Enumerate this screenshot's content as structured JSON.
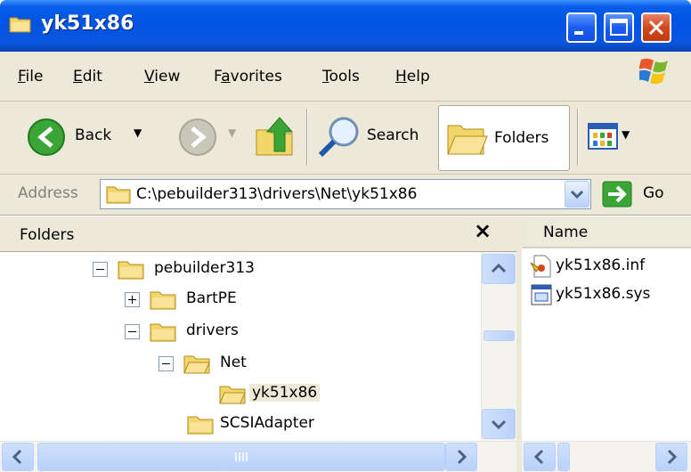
{
  "window": {
    "title": "yk51x86"
  },
  "menu": [
    {
      "label": "File",
      "mnemonic": "F",
      "rest": "ile"
    },
    {
      "label": "Edit",
      "mnemonic": "E",
      "rest": "dit"
    },
    {
      "label": "View",
      "mnemonic": "V",
      "rest": "iew"
    },
    {
      "label": "Favorites",
      "pre": "F",
      "mnemonic": "a",
      "rest": "vorites"
    },
    {
      "label": "Tools",
      "mnemonic": "T",
      "rest": "ools"
    },
    {
      "label": "Help",
      "mnemonic": "H",
      "rest": "elp"
    }
  ],
  "toolbar": {
    "back_label": "Back",
    "search_label": "Search",
    "folders_label": "Folders"
  },
  "address": {
    "label": "Address",
    "value": "C:\\pebuilder313\\drivers\\Net\\yk51x86",
    "go_label": "Go"
  },
  "folders_pane": {
    "title": "Folders",
    "close_glyph": "×",
    "nodes": [
      {
        "label": "pebuilder313",
        "expander": "minus"
      },
      {
        "label": "BartPE",
        "expander": "plus"
      },
      {
        "label": "drivers",
        "expander": "minus"
      },
      {
        "label": "Net",
        "expander": "minus"
      },
      {
        "label": "yk51x86",
        "expander": "none",
        "selected": true
      },
      {
        "label": "SCSIAdapter",
        "expander": "none"
      }
    ]
  },
  "details": {
    "column_name": "Name",
    "files": [
      {
        "name": "yk51x86.inf",
        "icon": "inf-file-icon"
      },
      {
        "name": "yk51x86.sys",
        "icon": "sys-file-icon"
      }
    ]
  },
  "colors": {
    "titlebar": "#0054e3",
    "chrome": "#ece9d8",
    "close_button": "#d4471c",
    "folder": "#f5d76e"
  }
}
